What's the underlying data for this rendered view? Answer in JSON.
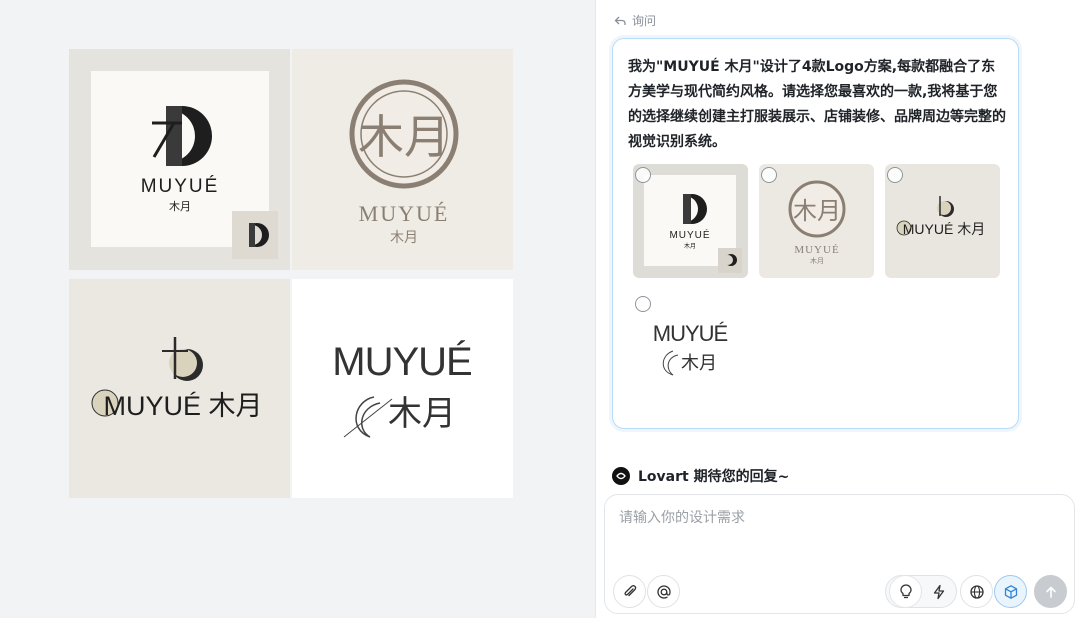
{
  "canvas": {
    "tiles": [
      {
        "brand": "MUYUÉ",
        "cn": "木月"
      },
      {
        "brand": "MUYUÉ",
        "cn": "木月"
      },
      {
        "brand": "MUYUÉ 木月"
      },
      {
        "brand": "MUYUÉ",
        "cn": "木月"
      }
    ]
  },
  "chat": {
    "ask_label": "询问",
    "message": "我为\"MUYUÉ 木月\"设计了4款Logo方案,每款都融合了东方美学与现代简约风格。请选择您最喜欢的一款,我将基于您的选择继续创建主打服装展示、店铺装修、品牌周边等完整的视觉识别系统。",
    "options": [
      {
        "brand": "MUYUÉ",
        "cn": "木月"
      },
      {
        "brand": "MUYUÉ",
        "cn": "木月"
      },
      {
        "brand": "MUYUÉ 木月"
      },
      {
        "brand": "MUYUÉ",
        "cn": "木月"
      }
    ],
    "status": "Lovart 期待您的回复~",
    "composer": {
      "placeholder": "请输入你的设计需求",
      "icons": [
        "paperclip-icon",
        "at-icon",
        "lightbulb-icon",
        "bolt-icon",
        "globe-icon",
        "cube-icon",
        "arrow-up-icon"
      ]
    }
  },
  "colors": {
    "accent_border": "#b9dcf7",
    "logo_taupe": "#8a7f72",
    "logo_dark": "#2b2b2b"
  }
}
